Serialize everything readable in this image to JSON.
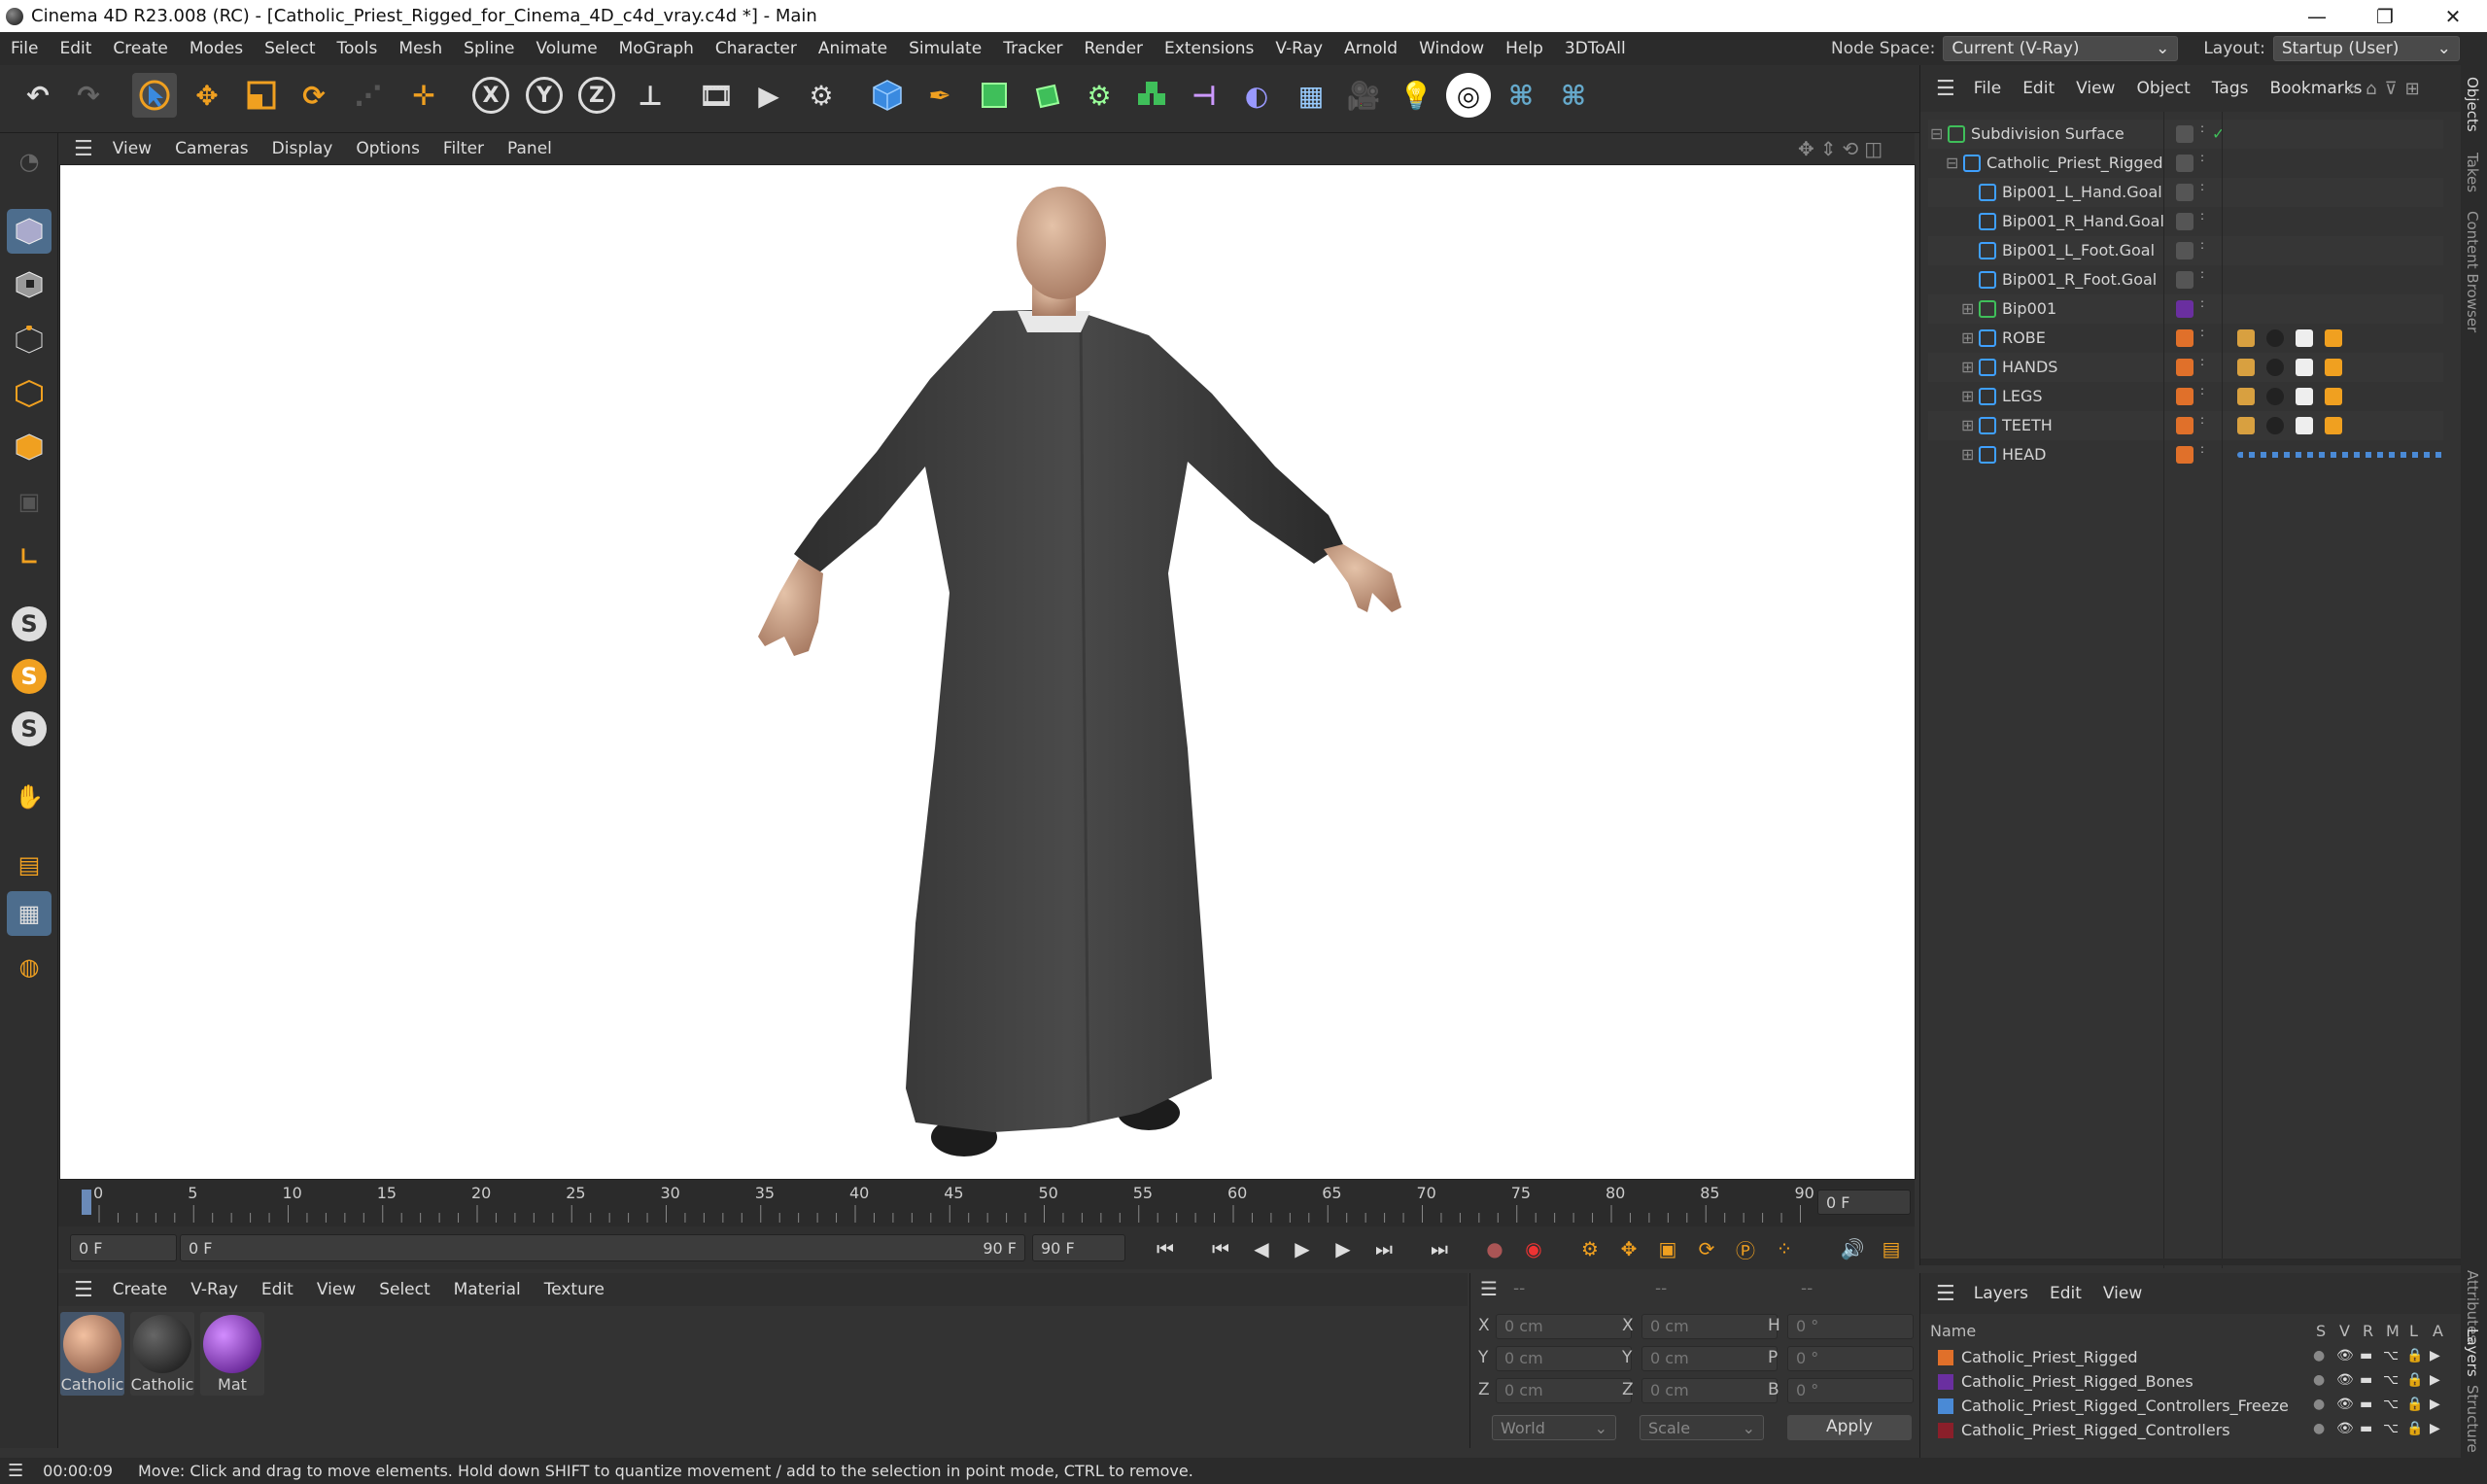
{
  "window": {
    "title": "Cinema 4D R23.008 (RC) - [Catholic_Priest_Rigged_for_Cinema_4D_c4d_vray.c4d *] - Main",
    "min": "—",
    "max": "❐",
    "close": "✕"
  },
  "menubar": {
    "items": [
      "File",
      "Edit",
      "Create",
      "Modes",
      "Select",
      "Tools",
      "Mesh",
      "Spline",
      "Volume",
      "MoGraph",
      "Character",
      "Animate",
      "Simulate",
      "Tracker",
      "Render",
      "Extensions",
      "V-Ray",
      "Arnold",
      "Window",
      "Help",
      "3DToAll"
    ],
    "node_space_label": "Node Space:",
    "node_space_value": "Current (V-Ray)",
    "layout_label": "Layout:",
    "layout_value": "Startup (User)"
  },
  "toolbar": {
    "icons": [
      "undo-icon",
      "redo-icon",
      "select-arrow-icon",
      "move-icon",
      "scale-icon",
      "rotate-icon",
      "tweak-icon",
      "recent-tools-icon",
      "x-axis-icon",
      "y-axis-icon",
      "z-axis-icon",
      "coordinate-system-icon",
      "render-view-icon",
      "render-active-icon",
      "render-settings-icon",
      "cube-icon",
      "pen-spline-icon",
      "subdivision-icon",
      "extrude-icon",
      "cloner-icon",
      "mograph-effector-icon",
      "deformer-icon",
      "field-icon",
      "floor-icon",
      "camera-icon",
      "light-icon",
      "vray-icon",
      "python-icon",
      "python-alt-icon"
    ],
    "axis": {
      "x": "X",
      "y": "Y",
      "z": "Z"
    }
  },
  "left_tools": {
    "s1": "S",
    "s2": "S",
    "s3": "S"
  },
  "viewport_menu": {
    "items": [
      "View",
      "Cameras",
      "Display",
      "Options",
      "Filter",
      "Panel"
    ]
  },
  "timeline": {
    "ticks": [
      "0",
      "5",
      "10",
      "15",
      "20",
      "25",
      "30",
      "35",
      "40",
      "45",
      "50",
      "55",
      "60",
      "65",
      "70",
      "75",
      "80",
      "85",
      "90"
    ],
    "current_frame": "0 F"
  },
  "time_controls": {
    "start": "0 F",
    "range_start": "0 F",
    "range_end": "90 F",
    "end": "90 F"
  },
  "material_menu": {
    "items": [
      "Create",
      "V-Ray",
      "Edit",
      "View",
      "Select",
      "Material",
      "Texture"
    ]
  },
  "materials": [
    {
      "name": "Catholic",
      "color": "#c98a6a",
      "selected": true
    },
    {
      "name": "Catholic",
      "color": "#2a2a2a",
      "selected": false
    },
    {
      "name": "Mat",
      "color": "#8a1fd6",
      "selected": false
    }
  ],
  "coords": {
    "header": "--",
    "col_headers": [
      "--",
      "--"
    ],
    "rows": [
      {
        "a": "X",
        "av": "0 cm",
        "b": "X",
        "bv": "0 cm",
        "c": "H",
        "cv": "0 °"
      },
      {
        "a": "Y",
        "av": "0 cm",
        "b": "Y",
        "bv": "0 cm",
        "c": "P",
        "cv": "0 °"
      },
      {
        "a": "Z",
        "av": "0 cm",
        "b": "Z",
        "bv": "0 cm",
        "c": "B",
        "cv": "0 °"
      }
    ],
    "world": "World",
    "scale": "Scale",
    "apply": "Apply"
  },
  "objects_menu": {
    "items": [
      "File",
      "Edit",
      "View",
      "Object",
      "Tags",
      "Bookmarks"
    ]
  },
  "objects": [
    {
      "name": "Subdivision Surface",
      "indent": 0,
      "icon": "#3fbf5a",
      "layer": ""
    },
    {
      "name": "Catholic_Priest_Rigged",
      "indent": 1,
      "icon": "#3fa0ff",
      "layer": ""
    },
    {
      "name": "Bip001_L_Hand.Goal",
      "indent": 2,
      "icon": "#3fa0ff",
      "layer": ""
    },
    {
      "name": "Bip001_R_Hand.Goal",
      "indent": 2,
      "icon": "#3fa0ff",
      "layer": ""
    },
    {
      "name": "Bip001_L_Foot.Goal",
      "indent": 2,
      "icon": "#3fa0ff",
      "layer": ""
    },
    {
      "name": "Bip001_R_Foot.Goal",
      "indent": 2,
      "icon": "#3fa0ff",
      "layer": ""
    },
    {
      "name": "Bip001",
      "indent": 2,
      "icon": "#3fbf5a",
      "layer": "#6a2fa0"
    },
    {
      "name": "ROBE",
      "indent": 2,
      "icon": "#3fa0ff",
      "layer": "#e0702a"
    },
    {
      "name": "HANDS",
      "indent": 2,
      "icon": "#3fa0ff",
      "layer": "#e0702a"
    },
    {
      "name": "LEGS",
      "indent": 2,
      "icon": "#3fa0ff",
      "layer": "#e0702a"
    },
    {
      "name": "TEETH",
      "indent": 2,
      "icon": "#3fa0ff",
      "layer": "#e0702a"
    },
    {
      "name": "HEAD",
      "indent": 2,
      "icon": "#3fa0ff",
      "layer": "#e0702a"
    }
  ],
  "layers_menu": {
    "items": [
      "Layers",
      "Edit",
      "View"
    ]
  },
  "layers_header": {
    "name": "Name",
    "cols": [
      "S",
      "V",
      "R",
      "M",
      "L",
      "A"
    ]
  },
  "layers": [
    {
      "name": "Catholic_Priest_Rigged",
      "color": "#e0702a"
    },
    {
      "name": "Catholic_Priest_Rigged_Bones",
      "color": "#6a2fa0"
    },
    {
      "name": "Catholic_Priest_Rigged_Controllers_Freeze",
      "color": "#4a8ad6"
    },
    {
      "name": "Catholic_Priest_Rigged_Controllers",
      "color": "#8a1f2a"
    }
  ],
  "right_tabs": [
    "Objects",
    "Takes",
    "Content Browser",
    "Attributes",
    "Layers",
    "Structure"
  ],
  "status": {
    "time": "00:00:09",
    "message": "Move: Click and drag to move elements. Hold down SHIFT to quantize movement / add to the selection in point mode, CTRL to remove."
  }
}
